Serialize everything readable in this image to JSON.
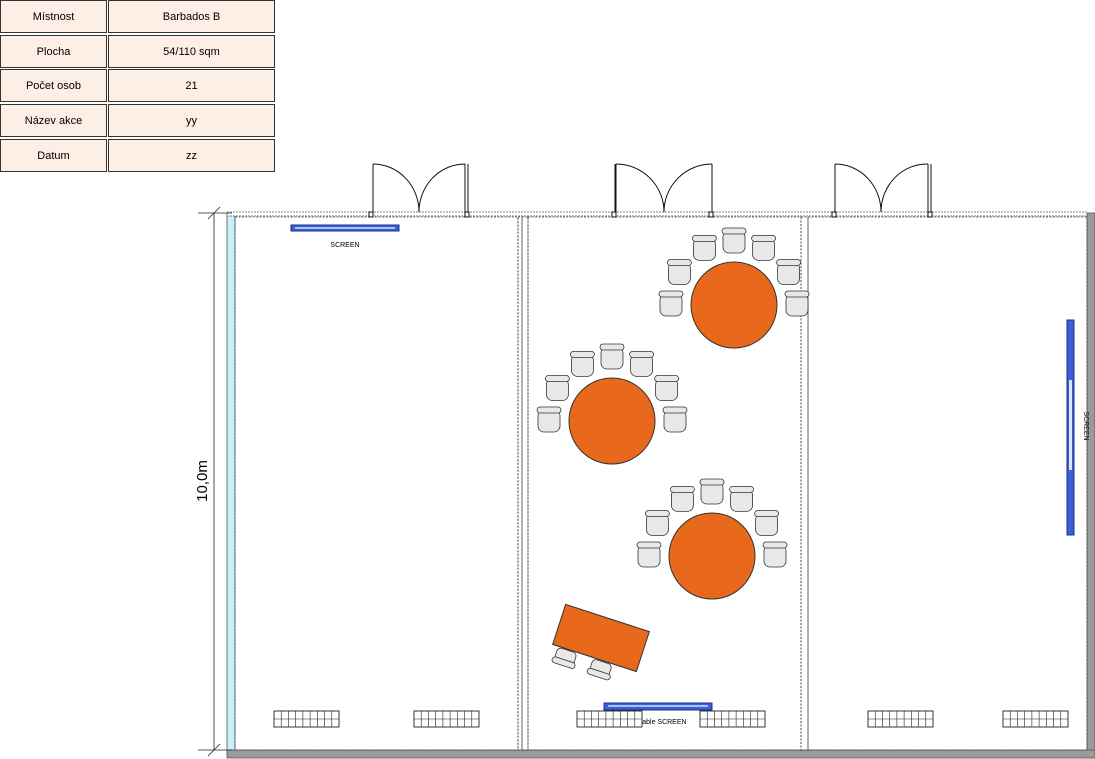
{
  "info_table": {
    "rows": [
      {
        "label": "Místnost",
        "value": "Barbados B"
      },
      {
        "label": "Plocha",
        "value": "54/110 sqm"
      },
      {
        "label": "Počet osob",
        "value": "21"
      },
      {
        "label": "Název akce",
        "value": "yy"
      },
      {
        "label": "Datum",
        "value": "zz"
      }
    ]
  },
  "floorplan": {
    "dimension_label": "10,0m",
    "screens": {
      "left_room": "SCREEN",
      "right_room": "SCREEN",
      "middle_room": "Portable SCREEN"
    },
    "colors": {
      "table": "#e8691b",
      "chair": "#e8e8e8",
      "screen": "#3a5fd9",
      "wall": "#9a9a9a",
      "window": "#c8f0f8"
    }
  }
}
